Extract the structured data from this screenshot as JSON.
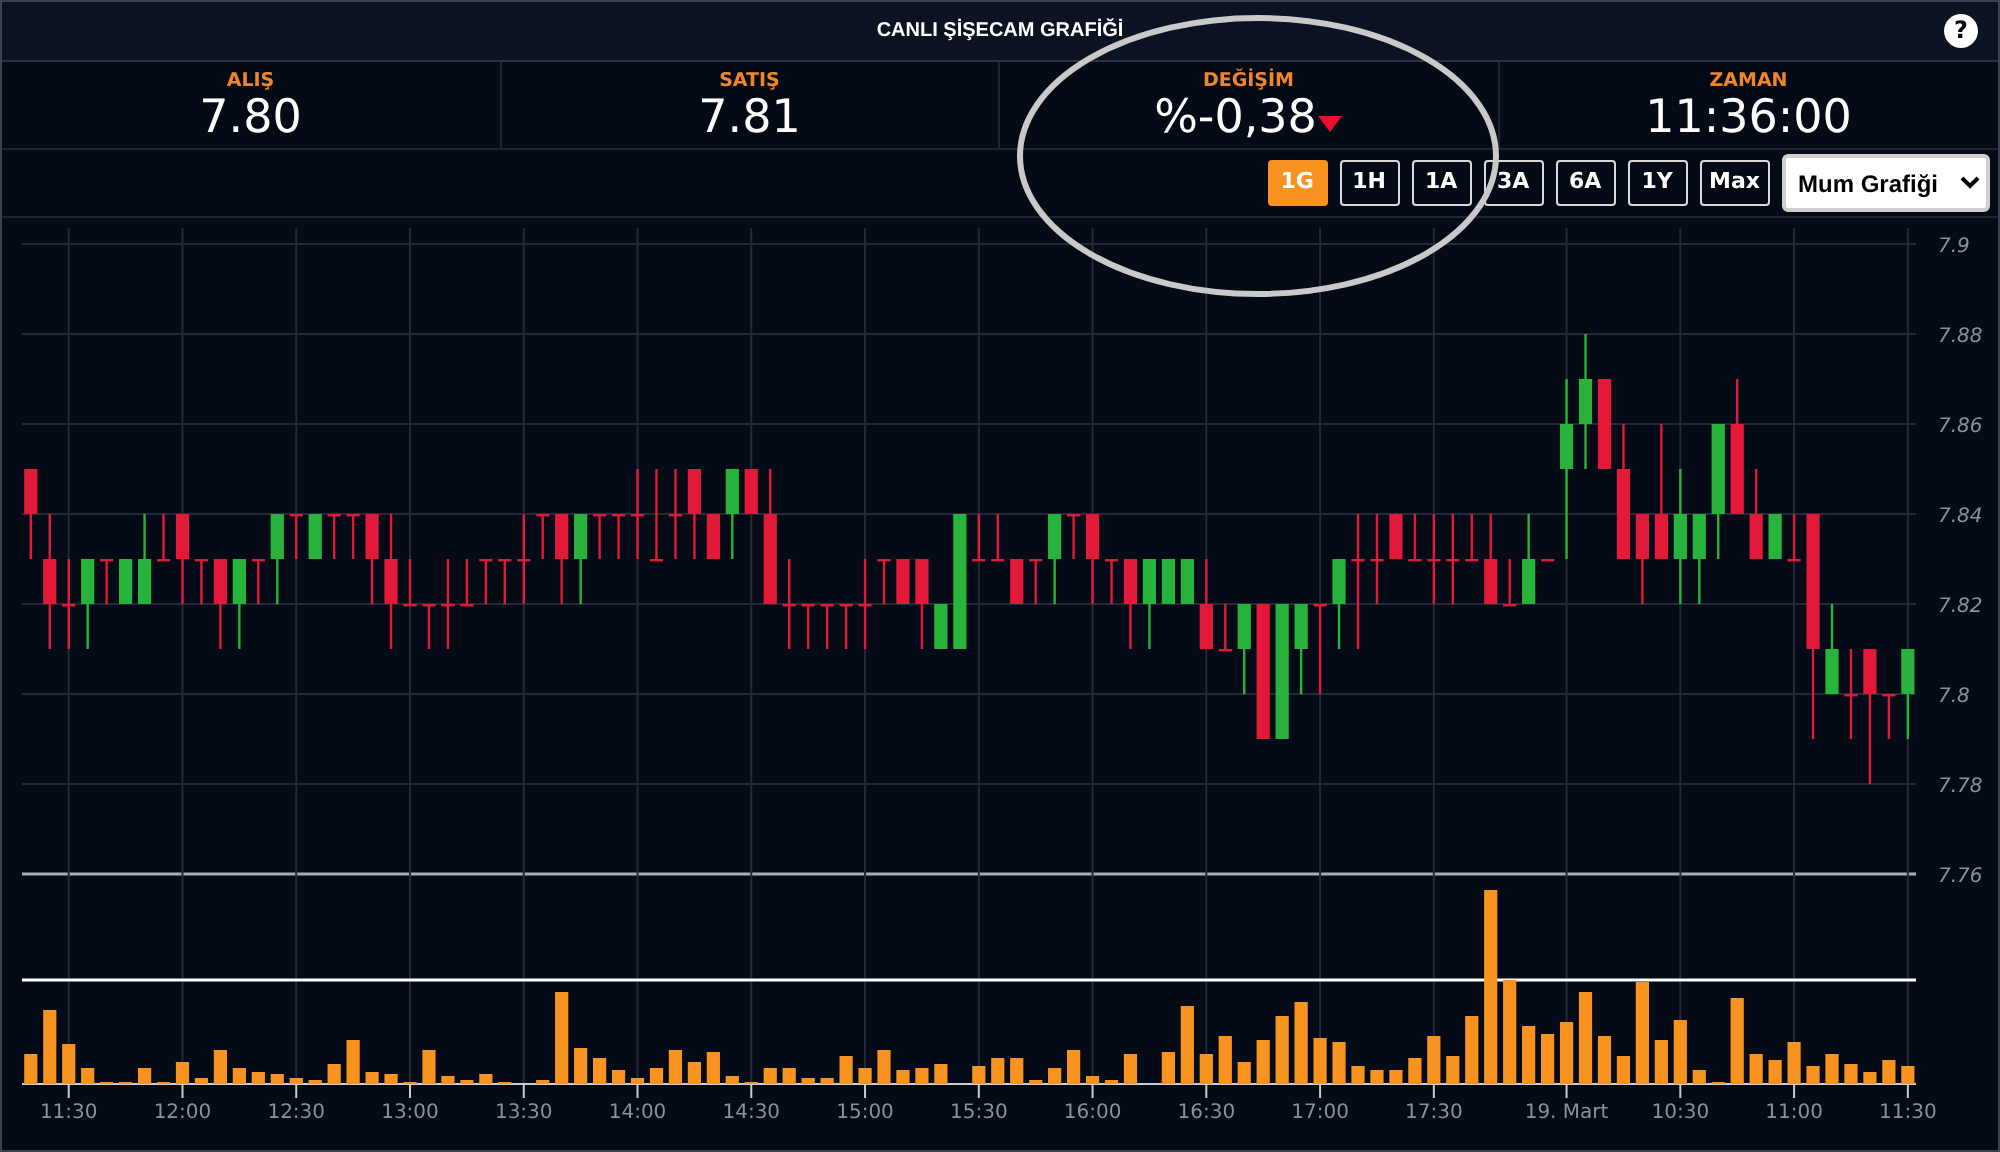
{
  "title": "CANLI ŞİŞECAM GRAFİĞİ",
  "help_label": "?",
  "stats": [
    {
      "label": "ALIŞ",
      "value": "7.80"
    },
    {
      "label": "SATIŞ",
      "value": "7.81"
    },
    {
      "label": "DEĞİŞİM",
      "value": "%-0,38",
      "falling": true
    },
    {
      "label": "ZAMAN",
      "value": "11:36:00"
    }
  ],
  "ranges": [
    {
      "label": "1G",
      "selected": true
    },
    {
      "label": "1H",
      "selected": false
    },
    {
      "label": "1A",
      "selected": false
    },
    {
      "label": "3A",
      "selected": false
    },
    {
      "label": "6A",
      "selected": false
    },
    {
      "label": "1Y",
      "selected": false
    },
    {
      "label": "Max",
      "selected": false
    }
  ],
  "chart_type_select": {
    "value": "Mum Grafiği"
  },
  "highlight": {
    "kind": "ellipse"
  },
  "chart": {
    "chart_data": {
      "type": "candlestick",
      "ylim": [
        7.76,
        7.9
      ],
      "yticks": [
        7.9,
        7.88,
        7.86,
        7.84,
        7.82,
        7.8,
        7.78,
        7.76
      ],
      "grid": true,
      "ohlc": [
        [
          7.85,
          7.85,
          7.83,
          7.84
        ],
        [
          7.83,
          7.84,
          7.81,
          7.82
        ],
        [
          7.82,
          7.83,
          7.81,
          7.82
        ],
        [
          7.82,
          7.83,
          7.81,
          7.83
        ],
        [
          7.83,
          7.83,
          7.82,
          7.83
        ],
        [
          7.82,
          7.83,
          7.82,
          7.83
        ],
        [
          7.82,
          7.84,
          7.82,
          7.83
        ],
        [
          7.83,
          7.84,
          7.83,
          7.83
        ],
        [
          7.84,
          7.84,
          7.82,
          7.83
        ],
        [
          7.83,
          7.83,
          7.82,
          7.83
        ],
        [
          7.83,
          7.83,
          7.81,
          7.82
        ],
        [
          7.82,
          7.83,
          7.81,
          7.83
        ],
        [
          7.83,
          7.83,
          7.82,
          7.83
        ],
        [
          7.83,
          7.84,
          7.82,
          7.84
        ],
        [
          7.84,
          7.84,
          7.83,
          7.84
        ],
        [
          7.83,
          7.84,
          7.83,
          7.84
        ],
        [
          7.84,
          7.84,
          7.83,
          7.84
        ],
        [
          7.84,
          7.84,
          7.83,
          7.84
        ],
        [
          7.84,
          7.84,
          7.82,
          7.83
        ],
        [
          7.83,
          7.84,
          7.81,
          7.82
        ],
        [
          7.82,
          7.83,
          7.82,
          7.82
        ],
        [
          7.82,
          7.82,
          7.81,
          7.82
        ],
        [
          7.82,
          7.83,
          7.81,
          7.82
        ],
        [
          7.82,
          7.83,
          7.82,
          7.82
        ],
        [
          7.83,
          7.83,
          7.82,
          7.83
        ],
        [
          7.83,
          7.83,
          7.82,
          7.83
        ],
        [
          7.83,
          7.84,
          7.82,
          7.83
        ],
        [
          7.84,
          7.84,
          7.83,
          7.84
        ],
        [
          7.84,
          7.84,
          7.82,
          7.83
        ],
        [
          7.83,
          7.84,
          7.82,
          7.84
        ],
        [
          7.84,
          7.84,
          7.83,
          7.84
        ],
        [
          7.84,
          7.84,
          7.83,
          7.84
        ],
        [
          7.84,
          7.85,
          7.83,
          7.84
        ],
        [
          7.83,
          7.85,
          7.83,
          7.83
        ],
        [
          7.84,
          7.85,
          7.83,
          7.84
        ],
        [
          7.85,
          7.85,
          7.83,
          7.84
        ],
        [
          7.84,
          7.84,
          7.83,
          7.83
        ],
        [
          7.84,
          7.85,
          7.83,
          7.85
        ],
        [
          7.85,
          7.85,
          7.84,
          7.84
        ],
        [
          7.84,
          7.85,
          7.82,
          7.82
        ],
        [
          7.82,
          7.83,
          7.81,
          7.82
        ],
        [
          7.82,
          7.82,
          7.81,
          7.82
        ],
        [
          7.82,
          7.82,
          7.81,
          7.82
        ],
        [
          7.82,
          7.82,
          7.81,
          7.82
        ],
        [
          7.82,
          7.83,
          7.81,
          7.82
        ],
        [
          7.83,
          7.83,
          7.82,
          7.83
        ],
        [
          7.83,
          7.83,
          7.82,
          7.82
        ],
        [
          7.83,
          7.83,
          7.81,
          7.82
        ],
        [
          7.81,
          7.82,
          7.81,
          7.82
        ],
        [
          7.81,
          7.84,
          7.81,
          7.84
        ],
        [
          7.83,
          7.84,
          7.83,
          7.83
        ],
        [
          7.83,
          7.84,
          7.83,
          7.83
        ],
        [
          7.83,
          7.83,
          7.82,
          7.82
        ],
        [
          7.83,
          7.83,
          7.82,
          7.83
        ],
        [
          7.83,
          7.84,
          7.82,
          7.84
        ],
        [
          7.84,
          7.84,
          7.83,
          7.84
        ],
        [
          7.84,
          7.84,
          7.82,
          7.83
        ],
        [
          7.83,
          7.83,
          7.82,
          7.83
        ],
        [
          7.83,
          7.83,
          7.81,
          7.82
        ],
        [
          7.82,
          7.83,
          7.81,
          7.83
        ],
        [
          7.82,
          7.83,
          7.82,
          7.83
        ],
        [
          7.82,
          7.83,
          7.82,
          7.83
        ],
        [
          7.82,
          7.83,
          7.81,
          7.81
        ],
        [
          7.81,
          7.82,
          7.81,
          7.81
        ],
        [
          7.81,
          7.82,
          7.8,
          7.82
        ],
        [
          7.82,
          7.82,
          7.79,
          7.79
        ],
        [
          7.79,
          7.82,
          7.79,
          7.82
        ],
        [
          7.81,
          7.82,
          7.8,
          7.82
        ],
        [
          7.82,
          7.82,
          7.8,
          7.82
        ],
        [
          7.82,
          7.83,
          7.81,
          7.83
        ],
        [
          7.83,
          7.84,
          7.81,
          7.83
        ],
        [
          7.83,
          7.84,
          7.82,
          7.83
        ],
        [
          7.84,
          7.84,
          7.83,
          7.83
        ],
        [
          7.83,
          7.84,
          7.83,
          7.83
        ],
        [
          7.83,
          7.84,
          7.82,
          7.83
        ],
        [
          7.83,
          7.84,
          7.82,
          7.83
        ],
        [
          7.83,
          7.84,
          7.83,
          7.83
        ],
        [
          7.83,
          7.84,
          7.82,
          7.82
        ],
        [
          7.82,
          7.83,
          7.82,
          7.82
        ],
        [
          7.82,
          7.84,
          7.82,
          7.83
        ],
        [
          7.83,
          7.83,
          7.83,
          7.83
        ],
        [
          7.85,
          7.87,
          7.83,
          7.86
        ],
        [
          7.86,
          7.88,
          7.85,
          7.87
        ],
        [
          7.87,
          7.87,
          7.85,
          7.85
        ],
        [
          7.85,
          7.86,
          7.83,
          7.83
        ],
        [
          7.84,
          7.84,
          7.82,
          7.83
        ],
        [
          7.84,
          7.86,
          7.83,
          7.83
        ],
        [
          7.83,
          7.85,
          7.82,
          7.84
        ],
        [
          7.83,
          7.84,
          7.82,
          7.84
        ],
        [
          7.84,
          7.86,
          7.83,
          7.86
        ],
        [
          7.86,
          7.87,
          7.84,
          7.84
        ],
        [
          7.84,
          7.85,
          7.83,
          7.83
        ],
        [
          7.83,
          7.84,
          7.83,
          7.84
        ],
        [
          7.83,
          7.84,
          7.83,
          7.83
        ],
        [
          7.84,
          7.84,
          7.79,
          7.81
        ],
        [
          7.8,
          7.82,
          7.8,
          7.81
        ],
        [
          7.8,
          7.81,
          7.79,
          7.8
        ],
        [
          7.81,
          7.81,
          7.78,
          7.8
        ],
        [
          7.8,
          7.8,
          7.79,
          7.8
        ],
        [
          7.8,
          7.81,
          7.79,
          7.81
        ]
      ]
    },
    "x_axis_labels": [
      "11:30",
      "12:00",
      "12:30",
      "13:00",
      "13:30",
      "14:00",
      "14:30",
      "15:00",
      "15:30",
      "16:00",
      "16:30",
      "17:00",
      "17:30",
      "19. Mart",
      "10:30",
      "11:00",
      "11:30"
    ]
  }
}
